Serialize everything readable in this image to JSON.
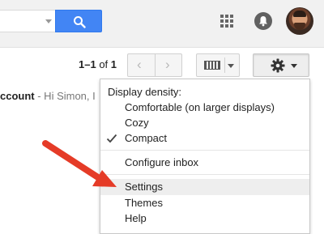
{
  "header": {
    "search_icon": "search-icon",
    "apps_icon": "apps-grid-icon",
    "notifications_icon": "bell-icon",
    "avatar_icon": "user-avatar"
  },
  "toolbar": {
    "range": "1–1",
    "of_label": "of",
    "total": "1",
    "prev_icon": "‹",
    "next_icon": "›",
    "keyboard_icon": "keyboard-icon",
    "settings_icon": "gear-icon"
  },
  "email": {
    "subject": "ccount",
    "snippet": " - Hi Simon, I"
  },
  "menu": {
    "heading": "Display density:",
    "density_options": [
      {
        "label": "Comfortable (on larger displays)",
        "checked": false
      },
      {
        "label": "Cozy",
        "checked": false
      },
      {
        "label": "Compact",
        "checked": true
      }
    ],
    "configure_inbox": "Configure inbox",
    "settings": "Settings",
    "themes": "Themes",
    "help": "Help"
  },
  "colors": {
    "accent_blue": "#4285f4",
    "arrow_red": "#e53b27"
  }
}
